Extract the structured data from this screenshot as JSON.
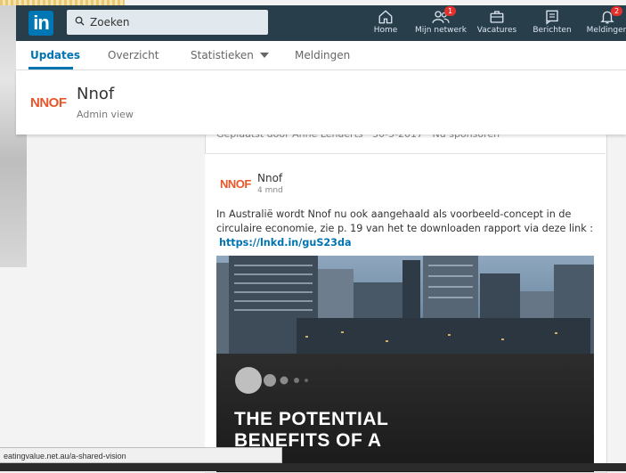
{
  "nav": {
    "search_placeholder": "Zoeken",
    "items": [
      {
        "label": "Home",
        "icon": "home-icon"
      },
      {
        "label": "Mijn netwerk",
        "icon": "network-icon",
        "badge": "1"
      },
      {
        "label": "Vacatures",
        "icon": "briefcase-icon"
      },
      {
        "label": "Berichten",
        "icon": "messages-icon"
      },
      {
        "label": "Meldingen",
        "icon": "bell-icon",
        "badge": "2"
      }
    ]
  },
  "subnav": {
    "tabs": [
      "Updates",
      "Overzicht",
      "Statistieken",
      "Meldingen"
    ]
  },
  "company": {
    "logo": "NNOF",
    "name": "Nnof",
    "role": "Admin view"
  },
  "feed": {
    "meta_line": "Geplaatst door Anne Lenaerts   ·   30-5-2017   ·   Nu sponsoren",
    "post": {
      "logo": "NNOF",
      "author": "Nnof",
      "time": "4 mnd",
      "text": "In Australië wordt Nnof nu ook aangehaald als voorbeeld-concept in de circulaire economie, zie p. 19 van het te downloaden rapport via deze link :",
      "link": "https://lnkd.in/guS23da",
      "image_title": "THE POTENTIAL\nBENEFITS OF A"
    }
  },
  "status_url": "eatingvalue.net.au/a-shared-vision",
  "colors": {
    "nav_bg": "#283e4a",
    "accent": "#0073b1",
    "nnof_orange": "#e8562a",
    "badge_red": "#e4302d"
  }
}
